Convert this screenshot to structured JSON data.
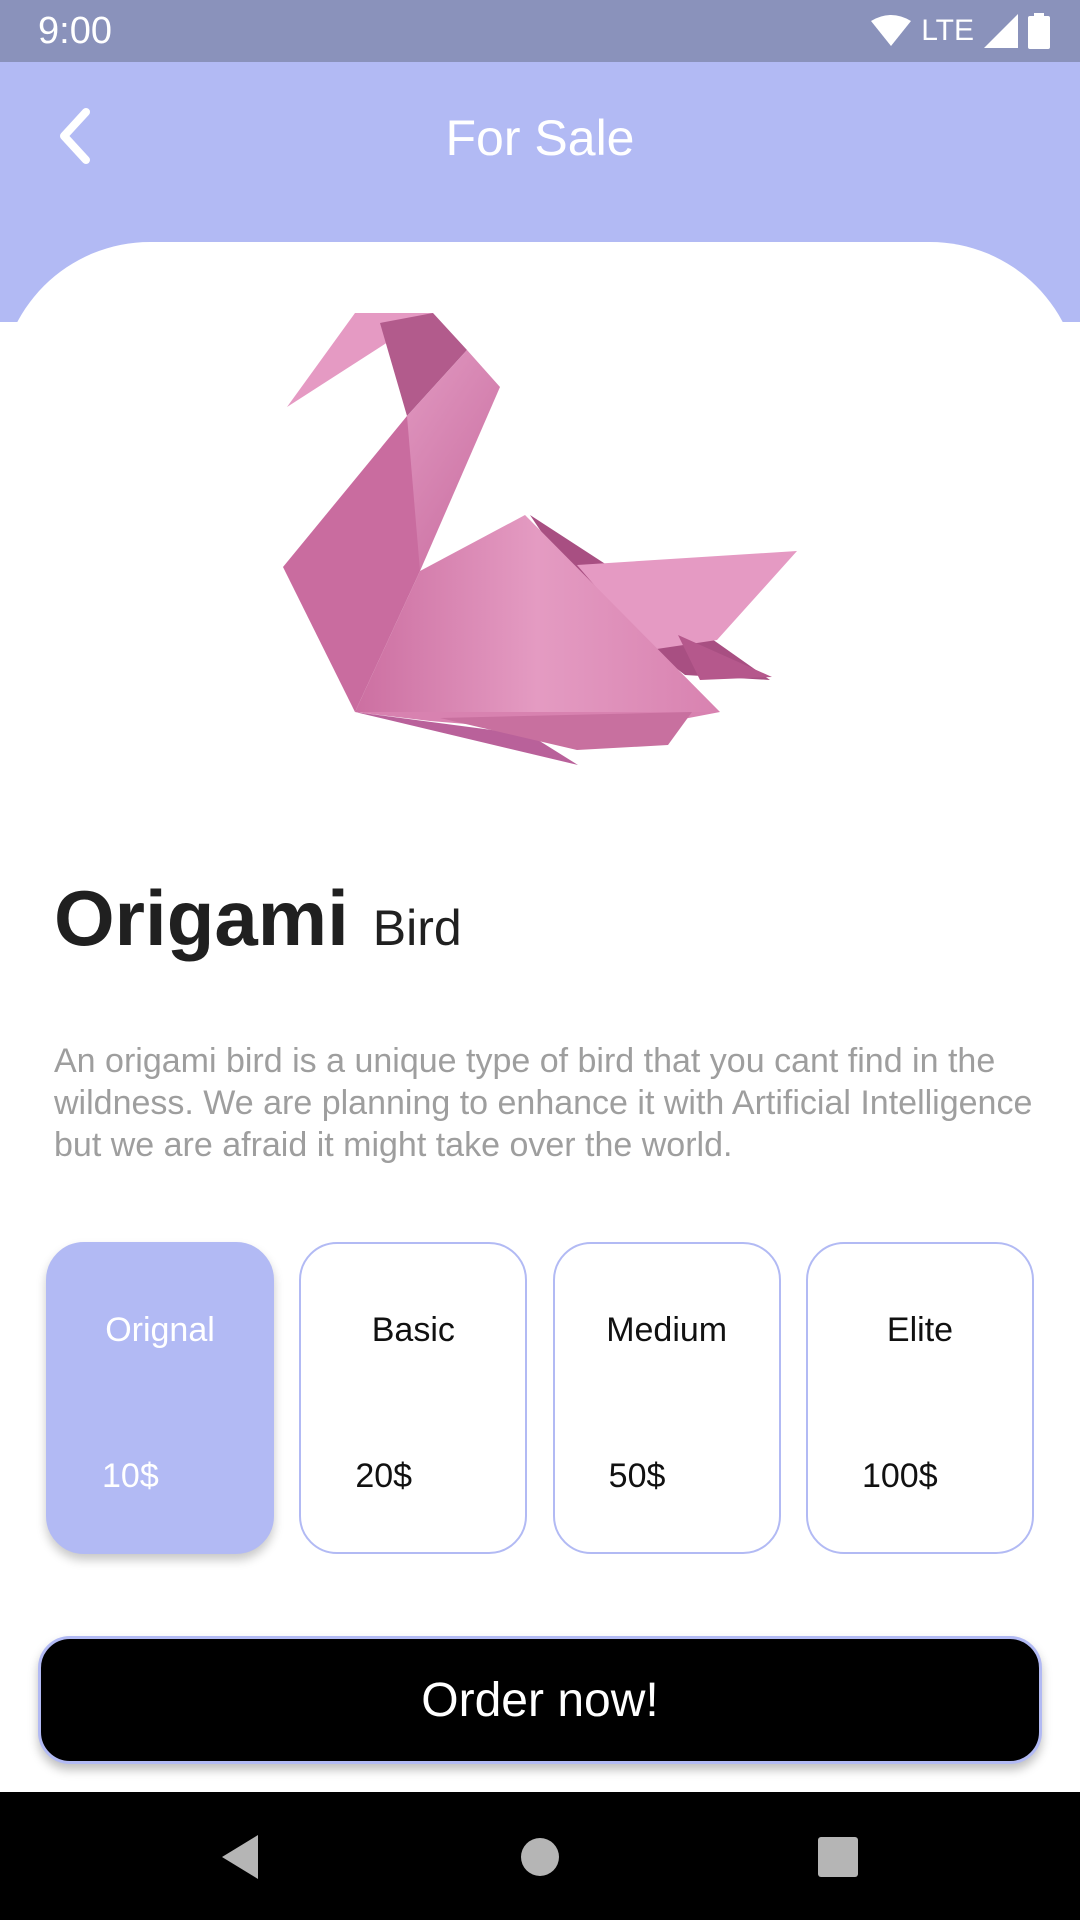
{
  "status": {
    "time": "9:00",
    "network": "LTE"
  },
  "header": {
    "title": "For Sale"
  },
  "product": {
    "name": "Origami",
    "type": "Bird",
    "description": "An origami bird is a unique type of bird that you cant find in the wildness. We are planning to enhance it with Artificial Intelligence but we are afraid it might take over the world."
  },
  "options": [
    {
      "label": "Orignal",
      "price": "10$",
      "selected": true
    },
    {
      "label": "Basic",
      "price": "20$",
      "selected": false
    },
    {
      "label": "Medium",
      "price": "50$",
      "selected": false
    },
    {
      "label": "Elite",
      "price": "100$",
      "selected": false
    }
  ],
  "order_button": {
    "label": "Order now!"
  },
  "colors": {
    "accent": "#b2baf4",
    "status_bar": "#8a92bb",
    "bird_pink": "#e39ac2"
  },
  "icons": {
    "back": "back-arrow-icon",
    "wifi": "wifi-icon",
    "signal": "signal-icon",
    "battery": "battery-icon",
    "nav_back": "nav-back-icon",
    "nav_home": "nav-home-icon",
    "nav_recents": "nav-recents-icon"
  }
}
